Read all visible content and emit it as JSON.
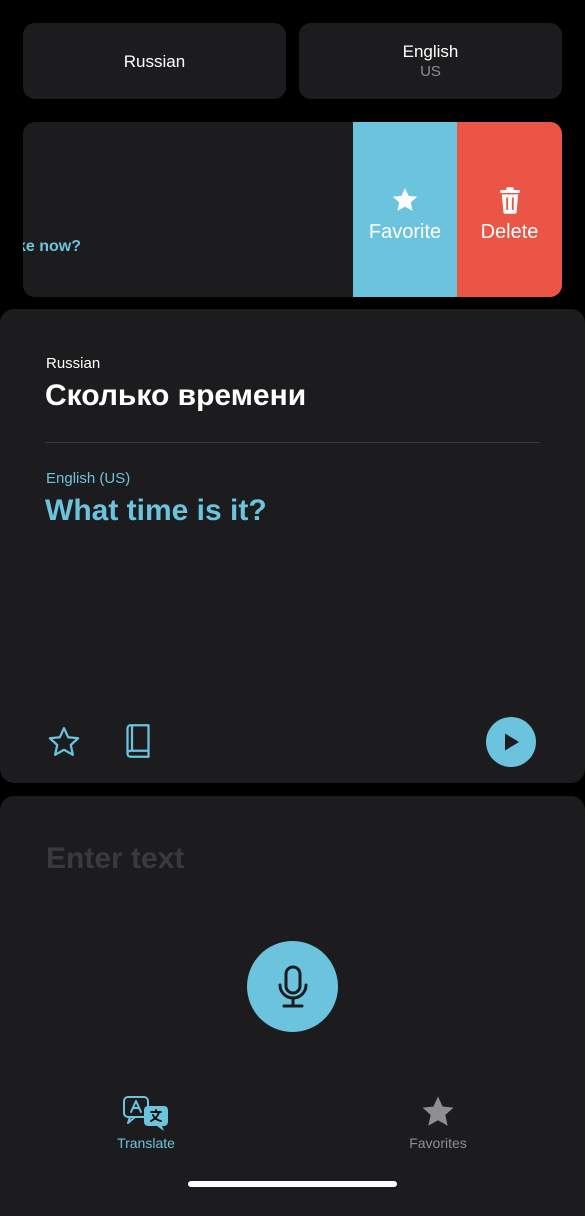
{
  "language_bar": {
    "source": {
      "name": "Russian"
    },
    "target": {
      "name": "English",
      "region": "US"
    }
  },
  "history": {
    "snippet": "ke now?",
    "actions": {
      "favorite_label": "Favorite",
      "favorite_icon": "star-icon",
      "delete_label": "Delete",
      "delete_icon": "trash-icon"
    }
  },
  "translation": {
    "source_language": "Russian",
    "source_text": "Сколько времени",
    "target_language": "English (US)",
    "target_text": "What time is it?",
    "icons": [
      "star-outline-icon",
      "book-icon",
      "play-icon"
    ]
  },
  "input": {
    "placeholder": "Enter text",
    "mic_icon": "microphone-icon"
  },
  "tab_bar": {
    "tabs": [
      {
        "label": "Translate",
        "icon": "translate-icon",
        "active": true
      },
      {
        "label": "Favorites",
        "icon": "star-icon",
        "active": false
      }
    ]
  },
  "colors": {
    "accent": "#6cc3dd",
    "delete": "#eb5545",
    "card": "#1c1c1e",
    "background": "#000000"
  }
}
